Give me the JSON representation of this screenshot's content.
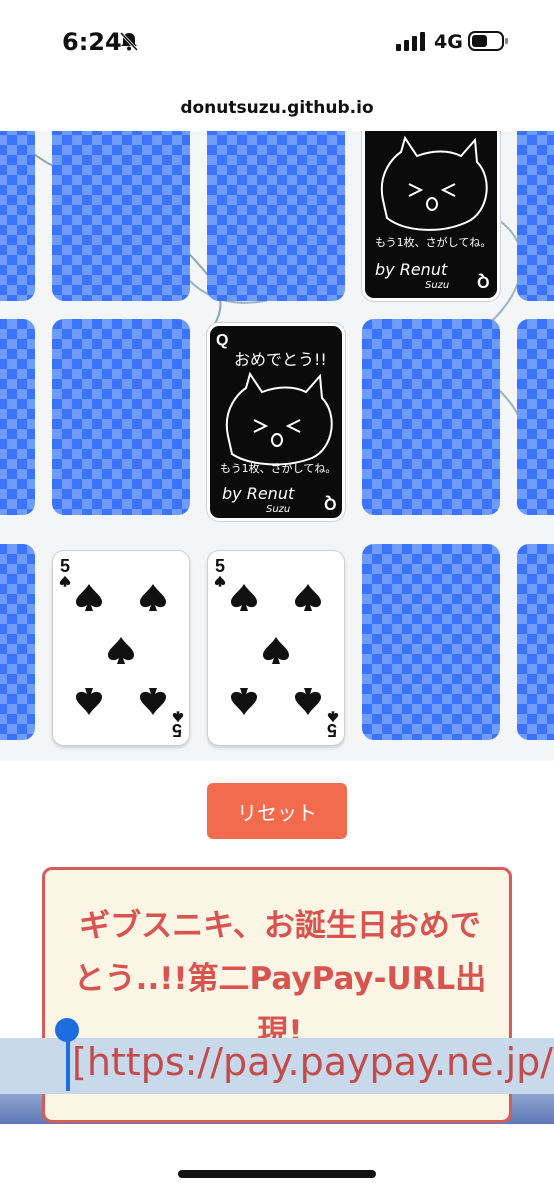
{
  "status_bar": {
    "time": "6:24",
    "network": "4G"
  },
  "browser": {
    "url": "donutsuzu.github.io"
  },
  "cards": {
    "open_card_rank": "5",
    "congrats_card": {
      "rank": "Q",
      "text_top": "おめでとう!!",
      "text_mid": "もう1枚、さがしてね。",
      "signature": "by Renut",
      "signature_sub": "Suzu"
    }
  },
  "controls": {
    "reset_label": "リセット"
  },
  "message": {
    "headline": "ギブスニキ、お誕生日おめでとう..!!第二PayPay-URL出現!",
    "link": "[https://pay.paypay.ne.jp/"
  },
  "colors": {
    "card_back": "#3b73ff",
    "reset": "#f36b4f",
    "message_text": "#d9534f"
  }
}
